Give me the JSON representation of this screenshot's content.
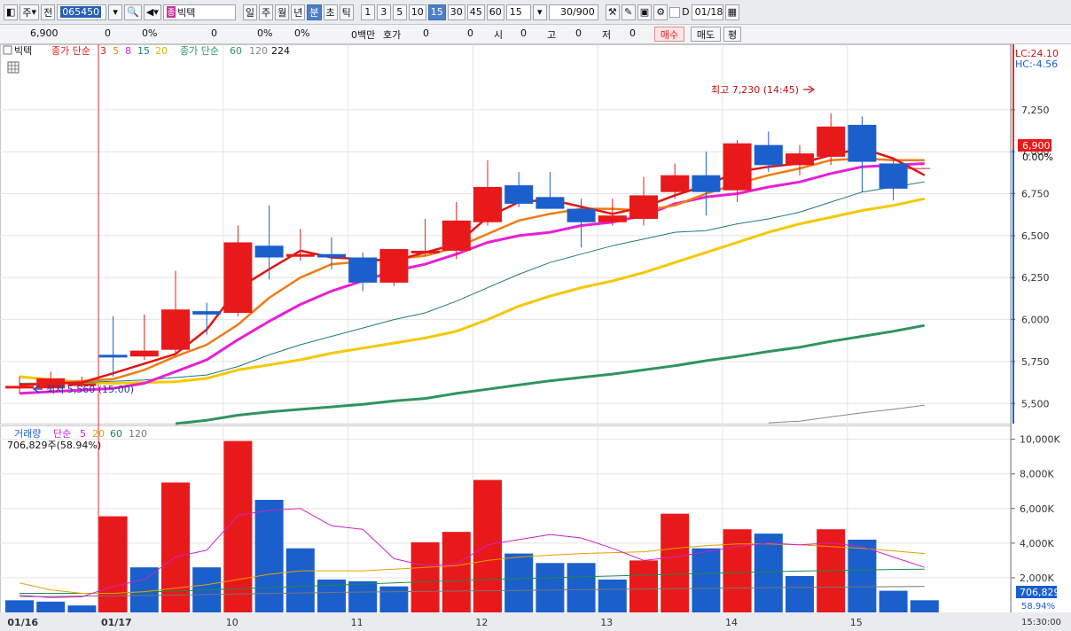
{
  "toolbar": {
    "mode1": "주",
    "mode2": "전",
    "code": "065450",
    "name": "빅텍",
    "name_badge": "종",
    "periods": [
      "일",
      "주",
      "월",
      "년",
      "분",
      "초",
      "틱"
    ],
    "minutes": [
      "1",
      "3",
      "5",
      "10",
      "15",
      "30",
      "45",
      "60"
    ],
    "interval": "15",
    "count": "30/900",
    "date": "01/18",
    "d_label": "D"
  },
  "quote": {
    "price": "6,900",
    "change": "0",
    "rate": "0%",
    "v1": "0",
    "r1": "0%",
    "r2": "0%",
    "volume_label": "0백만",
    "hoga_label": "호가",
    "hoga_v1": "0",
    "hoga_v2": "0",
    "open_label": "시",
    "open_val": "0",
    "high_label": "고",
    "high_val": "0",
    "low_label": "저",
    "low_val": "0",
    "buy_btn": "매수",
    "sell_btn": "매도",
    "eval_btn": "평"
  },
  "colors": {
    "up": "#e8191b",
    "down": "#1a5fcc",
    "ma3": "#e01515",
    "ma5": "#f07b14",
    "ma8": "#e81fd6",
    "ma15": "#1f7a7a",
    "ma20": "#f5c800",
    "ma60": "#2f9460",
    "ma120": "#888888",
    "vma5": "#d020c8",
    "vma20": "#e6a000",
    "vma60": "#1e8a46",
    "vma120": "#777777"
  },
  "chart_data": [
    {
      "type": "candlestick",
      "legend": {
        "name": "빅텍",
        "ma1_label": "종가 단순",
        "ma1_periods": [
          "3",
          "5",
          "8",
          "15",
          "20"
        ],
        "ma2_label": "종가 단순",
        "ma2_periods": [
          "60",
          "120",
          "224"
        ]
      },
      "right_labels": {
        "lc": "LC:24.10",
        "hc": "HC:-4.56",
        "price": "6,900",
        "pct": "0.00%"
      },
      "y_ticks": [
        "7,250",
        "7,000",
        "6,750",
        "6,500",
        "6,250",
        "6,000",
        "5,750",
        "5,500"
      ],
      "ylim": [
        5380,
        7640
      ],
      "annotations": {
        "max": "최고 7,230 (14:45)",
        "min": "최저 5,560 (15:00)"
      },
      "candles": [
        {
          "o": 5605,
          "h": 5660,
          "l": 5560,
          "c": 5605
        },
        {
          "o": 5590,
          "h": 5690,
          "l": 5575,
          "c": 5650
        },
        {
          "o": 5620,
          "h": 5660,
          "l": 5595,
          "c": 5620
        },
        {
          "o": 5790,
          "h": 6020,
          "l": 5660,
          "c": 5775
        },
        {
          "o": 5780,
          "h": 6030,
          "l": 5760,
          "c": 5815
        },
        {
          "o": 5820,
          "h": 6290,
          "l": 5790,
          "c": 6060
        },
        {
          "o": 6050,
          "h": 6100,
          "l": 5910,
          "c": 6030
        },
        {
          "o": 6040,
          "h": 6560,
          "l": 6020,
          "c": 6460
        },
        {
          "o": 6440,
          "h": 6680,
          "l": 6240,
          "c": 6370
        },
        {
          "o": 6390,
          "h": 6540,
          "l": 6350,
          "c": 6390
        },
        {
          "o": 6390,
          "h": 6490,
          "l": 6300,
          "c": 6370
        },
        {
          "o": 6370,
          "h": 6400,
          "l": 6170,
          "c": 6220
        },
        {
          "o": 6220,
          "h": 6420,
          "l": 6200,
          "c": 6420
        },
        {
          "o": 6400,
          "h": 6600,
          "l": 6380,
          "c": 6410
        },
        {
          "o": 6410,
          "h": 6700,
          "l": 6360,
          "c": 6590
        },
        {
          "o": 6580,
          "h": 6950,
          "l": 6560,
          "c": 6790
        },
        {
          "o": 6800,
          "h": 6880,
          "l": 6670,
          "c": 6690
        },
        {
          "o": 6730,
          "h": 6880,
          "l": 6660,
          "c": 6660
        },
        {
          "o": 6660,
          "h": 6720,
          "l": 6430,
          "c": 6580
        },
        {
          "o": 6580,
          "h": 6720,
          "l": 6560,
          "c": 6620
        },
        {
          "o": 6600,
          "h": 6850,
          "l": 6560,
          "c": 6740
        },
        {
          "o": 6760,
          "h": 6930,
          "l": 6720,
          "c": 6860
        },
        {
          "o": 6860,
          "h": 7000,
          "l": 6620,
          "c": 6760
        },
        {
          "o": 6770,
          "h": 7070,
          "l": 6700,
          "c": 7050
        },
        {
          "o": 7040,
          "h": 7120,
          "l": 6880,
          "c": 6920
        },
        {
          "o": 6920,
          "h": 7040,
          "l": 6860,
          "c": 6990
        },
        {
          "o": 6970,
          "h": 7230,
          "l": 6920,
          "c": 7150
        },
        {
          "o": 7160,
          "h": 7210,
          "l": 6760,
          "c": 6940
        },
        {
          "o": 6930,
          "h": 6960,
          "l": 6710,
          "c": 6780
        }
      ],
      "ma3": [
        [
          0,
          5610
        ],
        [
          2,
          5625
        ],
        [
          3,
          5680
        ],
        [
          5,
          5795
        ],
        [
          6,
          5940
        ],
        [
          7,
          6185
        ],
        [
          8,
          6300
        ],
        [
          9,
          6410
        ],
        [
          10,
          6370
        ],
        [
          12,
          6350
        ],
        [
          14,
          6450
        ],
        [
          15,
          6610
        ],
        [
          16,
          6700
        ],
        [
          17,
          6715
        ],
        [
          19,
          6630
        ],
        [
          20,
          6670
        ],
        [
          21,
          6740
        ],
        [
          22,
          6800
        ],
        [
          23,
          6880
        ],
        [
          24,
          6910
        ],
        [
          25,
          6930
        ],
        [
          26,
          6980
        ],
        [
          27,
          7020
        ],
        [
          28,
          6960
        ],
        [
          29,
          6860
        ]
      ],
      "ma5": [
        [
          0,
          5610
        ],
        [
          3,
          5645
        ],
        [
          4,
          5700
        ],
        [
          5,
          5780
        ],
        [
          6,
          5850
        ],
        [
          7,
          5970
        ],
        [
          8,
          6130
        ],
        [
          9,
          6250
        ],
        [
          10,
          6330
        ],
        [
          12,
          6360
        ],
        [
          13,
          6380
        ],
        [
          14,
          6430
        ],
        [
          15,
          6510
        ],
        [
          16,
          6590
        ],
        [
          17,
          6630
        ],
        [
          18,
          6660
        ],
        [
          19,
          6660
        ],
        [
          20,
          6650
        ],
        [
          21,
          6680
        ],
        [
          22,
          6750
        ],
        [
          23,
          6810
        ],
        [
          24,
          6860
        ],
        [
          25,
          6900
        ],
        [
          26,
          6950
        ],
        [
          27,
          6960
        ],
        [
          28,
          6950
        ],
        [
          29,
          6950
        ]
      ],
      "ma8": [
        [
          0,
          5560
        ],
        [
          3,
          5590
        ],
        [
          4,
          5620
        ],
        [
          5,
          5690
        ],
        [
          6,
          5760
        ],
        [
          7,
          5880
        ],
        [
          8,
          5990
        ],
        [
          9,
          6090
        ],
        [
          10,
          6170
        ],
        [
          11,
          6230
        ],
        [
          12,
          6290
        ],
        [
          13,
          6330
        ],
        [
          14,
          6390
        ],
        [
          15,
          6460
        ],
        [
          16,
          6500
        ],
        [
          17,
          6520
        ],
        [
          18,
          6560
        ],
        [
          19,
          6580
        ],
        [
          20,
          6620
        ],
        [
          21,
          6690
        ],
        [
          22,
          6730
        ],
        [
          23,
          6750
        ],
        [
          24,
          6790
        ],
        [
          25,
          6820
        ],
        [
          26,
          6870
        ],
        [
          27,
          6910
        ],
        [
          28,
          6920
        ],
        [
          29,
          6930
        ]
      ],
      "ma15": [
        [
          0,
          5620
        ],
        [
          2,
          5625
        ],
        [
          4,
          5640
        ],
        [
          6,
          5670
        ],
        [
          7,
          5720
        ],
        [
          8,
          5790
        ],
        [
          9,
          5850
        ],
        [
          10,
          5900
        ],
        [
          11,
          5950
        ],
        [
          12,
          6000
        ],
        [
          13,
          6040
        ],
        [
          14,
          6110
        ],
        [
          15,
          6190
        ],
        [
          16,
          6270
        ],
        [
          17,
          6340
        ],
        [
          18,
          6390
        ],
        [
          19,
          6440
        ],
        [
          20,
          6480
        ],
        [
          21,
          6520
        ],
        [
          22,
          6530
        ],
        [
          23,
          6570
        ],
        [
          24,
          6600
        ],
        [
          25,
          6640
        ],
        [
          26,
          6700
        ],
        [
          27,
          6760
        ],
        [
          28,
          6790
        ],
        [
          29,
          6820
        ]
      ],
      "ma20": [
        [
          0,
          5660
        ],
        [
          2,
          5625
        ],
        [
          3,
          5620
        ],
        [
          5,
          5630
        ],
        [
          6,
          5650
        ],
        [
          7,
          5700
        ],
        [
          8,
          5730
        ],
        [
          9,
          5760
        ],
        [
          10,
          5800
        ],
        [
          11,
          5830
        ],
        [
          12,
          5860
        ],
        [
          13,
          5890
        ],
        [
          14,
          5930
        ],
        [
          15,
          6000
        ],
        [
          16,
          6080
        ],
        [
          17,
          6140
        ],
        [
          18,
          6190
        ],
        [
          19,
          6230
        ],
        [
          20,
          6280
        ],
        [
          21,
          6340
        ],
        [
          22,
          6400
        ],
        [
          23,
          6460
        ],
        [
          24,
          6520
        ],
        [
          25,
          6570
        ],
        [
          26,
          6610
        ],
        [
          27,
          6650
        ],
        [
          28,
          6680
        ],
        [
          29,
          6720
        ]
      ],
      "ma60": [
        [
          5,
          5380
        ],
        [
          6,
          5400
        ],
        [
          7,
          5430
        ],
        [
          8,
          5450
        ],
        [
          9,
          5465
        ],
        [
          10,
          5480
        ],
        [
          11,
          5495
        ],
        [
          12,
          5515
        ],
        [
          13,
          5530
        ],
        [
          14,
          5560
        ],
        [
          15,
          5585
        ],
        [
          16,
          5610
        ],
        [
          17,
          5635
        ],
        [
          18,
          5655
        ],
        [
          19,
          5675
        ],
        [
          20,
          5700
        ],
        [
          21,
          5725
        ],
        [
          22,
          5755
        ],
        [
          23,
          5780
        ],
        [
          24,
          5810
        ],
        [
          25,
          5835
        ],
        [
          26,
          5870
        ],
        [
          27,
          5900
        ],
        [
          28,
          5930
        ],
        [
          29,
          5965
        ]
      ],
      "ma120": [
        [
          24,
          5385
        ],
        [
          25,
          5395
        ],
        [
          26,
          5420
        ],
        [
          27,
          5445
        ],
        [
          28,
          5465
        ],
        [
          29,
          5490
        ]
      ]
    },
    {
      "type": "bar",
      "legend": {
        "name": "거래량",
        "ma_label": "단순",
        "ma_periods": [
          "5",
          "20",
          "60",
          "120"
        ],
        "volume_text": "706,829주(58.94%)"
      },
      "right_labels": {
        "vol": "706,829",
        "pct": "58.94%"
      },
      "y_ticks": [
        "10,000K",
        "8,000K",
        "6,000K",
        "4,000K",
        "2,000K"
      ],
      "ylim": [
        0,
        10800
      ],
      "values": [
        700,
        620,
        400,
        5550,
        2600,
        7500,
        2600,
        9900,
        6500,
        3700,
        1900,
        1800,
        1500,
        4050,
        4650,
        7650,
        3400,
        2850,
        2850,
        1900,
        3000,
        5700,
        3700,
        4800,
        4550,
        2100,
        4800,
        4200,
        1250,
        700
      ],
      "colors": [
        "d",
        "d",
        "d",
        "u",
        "d",
        "u",
        "d",
        "u",
        "d",
        "d",
        "d",
        "d",
        "d",
        "u",
        "u",
        "u",
        "d",
        "d",
        "d",
        "d",
        "u",
        "u",
        "d",
        "u",
        "d",
        "d",
        "u",
        "d",
        "d",
        "d"
      ],
      "vma5": [
        [
          0,
          1000
        ],
        [
          1,
          850
        ],
        [
          2,
          900
        ],
        [
          3,
          1500
        ],
        [
          4,
          1900
        ],
        [
          5,
          3200
        ],
        [
          6,
          3600
        ],
        [
          7,
          5600
        ],
        [
          8,
          5900
        ],
        [
          9,
          6000
        ],
        [
          10,
          5000
        ],
        [
          11,
          4800
        ],
        [
          12,
          3100
        ],
        [
          13,
          2700
        ],
        [
          14,
          2800
        ],
        [
          15,
          3900
        ],
        [
          16,
          4200
        ],
        [
          17,
          4500
        ],
        [
          18,
          4300
        ],
        [
          19,
          3700
        ],
        [
          20,
          3000
        ],
        [
          21,
          3200
        ],
        [
          22,
          3500
        ],
        [
          23,
          3800
        ],
        [
          24,
          4000
        ],
        [
          25,
          3900
        ],
        [
          26,
          4000
        ],
        [
          27,
          3800
        ],
        [
          28,
          3200
        ],
        [
          29,
          2600
        ]
      ],
      "vma20": [
        [
          0,
          1700
        ],
        [
          1,
          1300
        ],
        [
          2,
          1100
        ],
        [
          3,
          1100
        ],
        [
          4,
          1200
        ],
        [
          5,
          1400
        ],
        [
          6,
          1600
        ],
        [
          7,
          1900
        ],
        [
          8,
          2200
        ],
        [
          9,
          2400
        ],
        [
          10,
          2400
        ],
        [
          11,
          2400
        ],
        [
          12,
          2500
        ],
        [
          13,
          2600
        ],
        [
          14,
          2700
        ],
        [
          15,
          3000
        ],
        [
          16,
          3200
        ],
        [
          17,
          3300
        ],
        [
          18,
          3400
        ],
        [
          19,
          3450
        ],
        [
          20,
          3500
        ],
        [
          21,
          3700
        ],
        [
          22,
          3850
        ],
        [
          23,
          3950
        ],
        [
          24,
          3950
        ],
        [
          25,
          3900
        ],
        [
          26,
          3800
        ],
        [
          27,
          3700
        ],
        [
          28,
          3550
        ],
        [
          29,
          3400
        ]
      ],
      "vma60": [
        [
          0,
          1100
        ],
        [
          3,
          1100
        ],
        [
          6,
          1300
        ],
        [
          9,
          1500
        ],
        [
          12,
          1700
        ],
        [
          15,
          1900
        ],
        [
          18,
          2050
        ],
        [
          21,
          2200
        ],
        [
          24,
          2350
        ],
        [
          27,
          2450
        ],
        [
          29,
          2500
        ]
      ],
      "vma120": [
        [
          0,
          900
        ],
        [
          5,
          1000
        ],
        [
          10,
          1150
        ],
        [
          15,
          1250
        ],
        [
          20,
          1350
        ],
        [
          25,
          1450
        ],
        [
          29,
          1500
        ]
      ]
    }
  ],
  "x_axis": {
    "labels": [
      {
        "i": 0,
        "text": "01/16",
        "bold": true
      },
      {
        "i": 3,
        "text": "01/17",
        "bold": true
      },
      {
        "i": 7,
        "text": "10"
      },
      {
        "i": 11,
        "text": "11"
      },
      {
        "i": 15,
        "text": "12"
      },
      {
        "i": 19,
        "text": "13"
      },
      {
        "i": 23,
        "text": "14"
      },
      {
        "i": 27,
        "text": "15"
      }
    ],
    "end_time": "15:30:00"
  }
}
